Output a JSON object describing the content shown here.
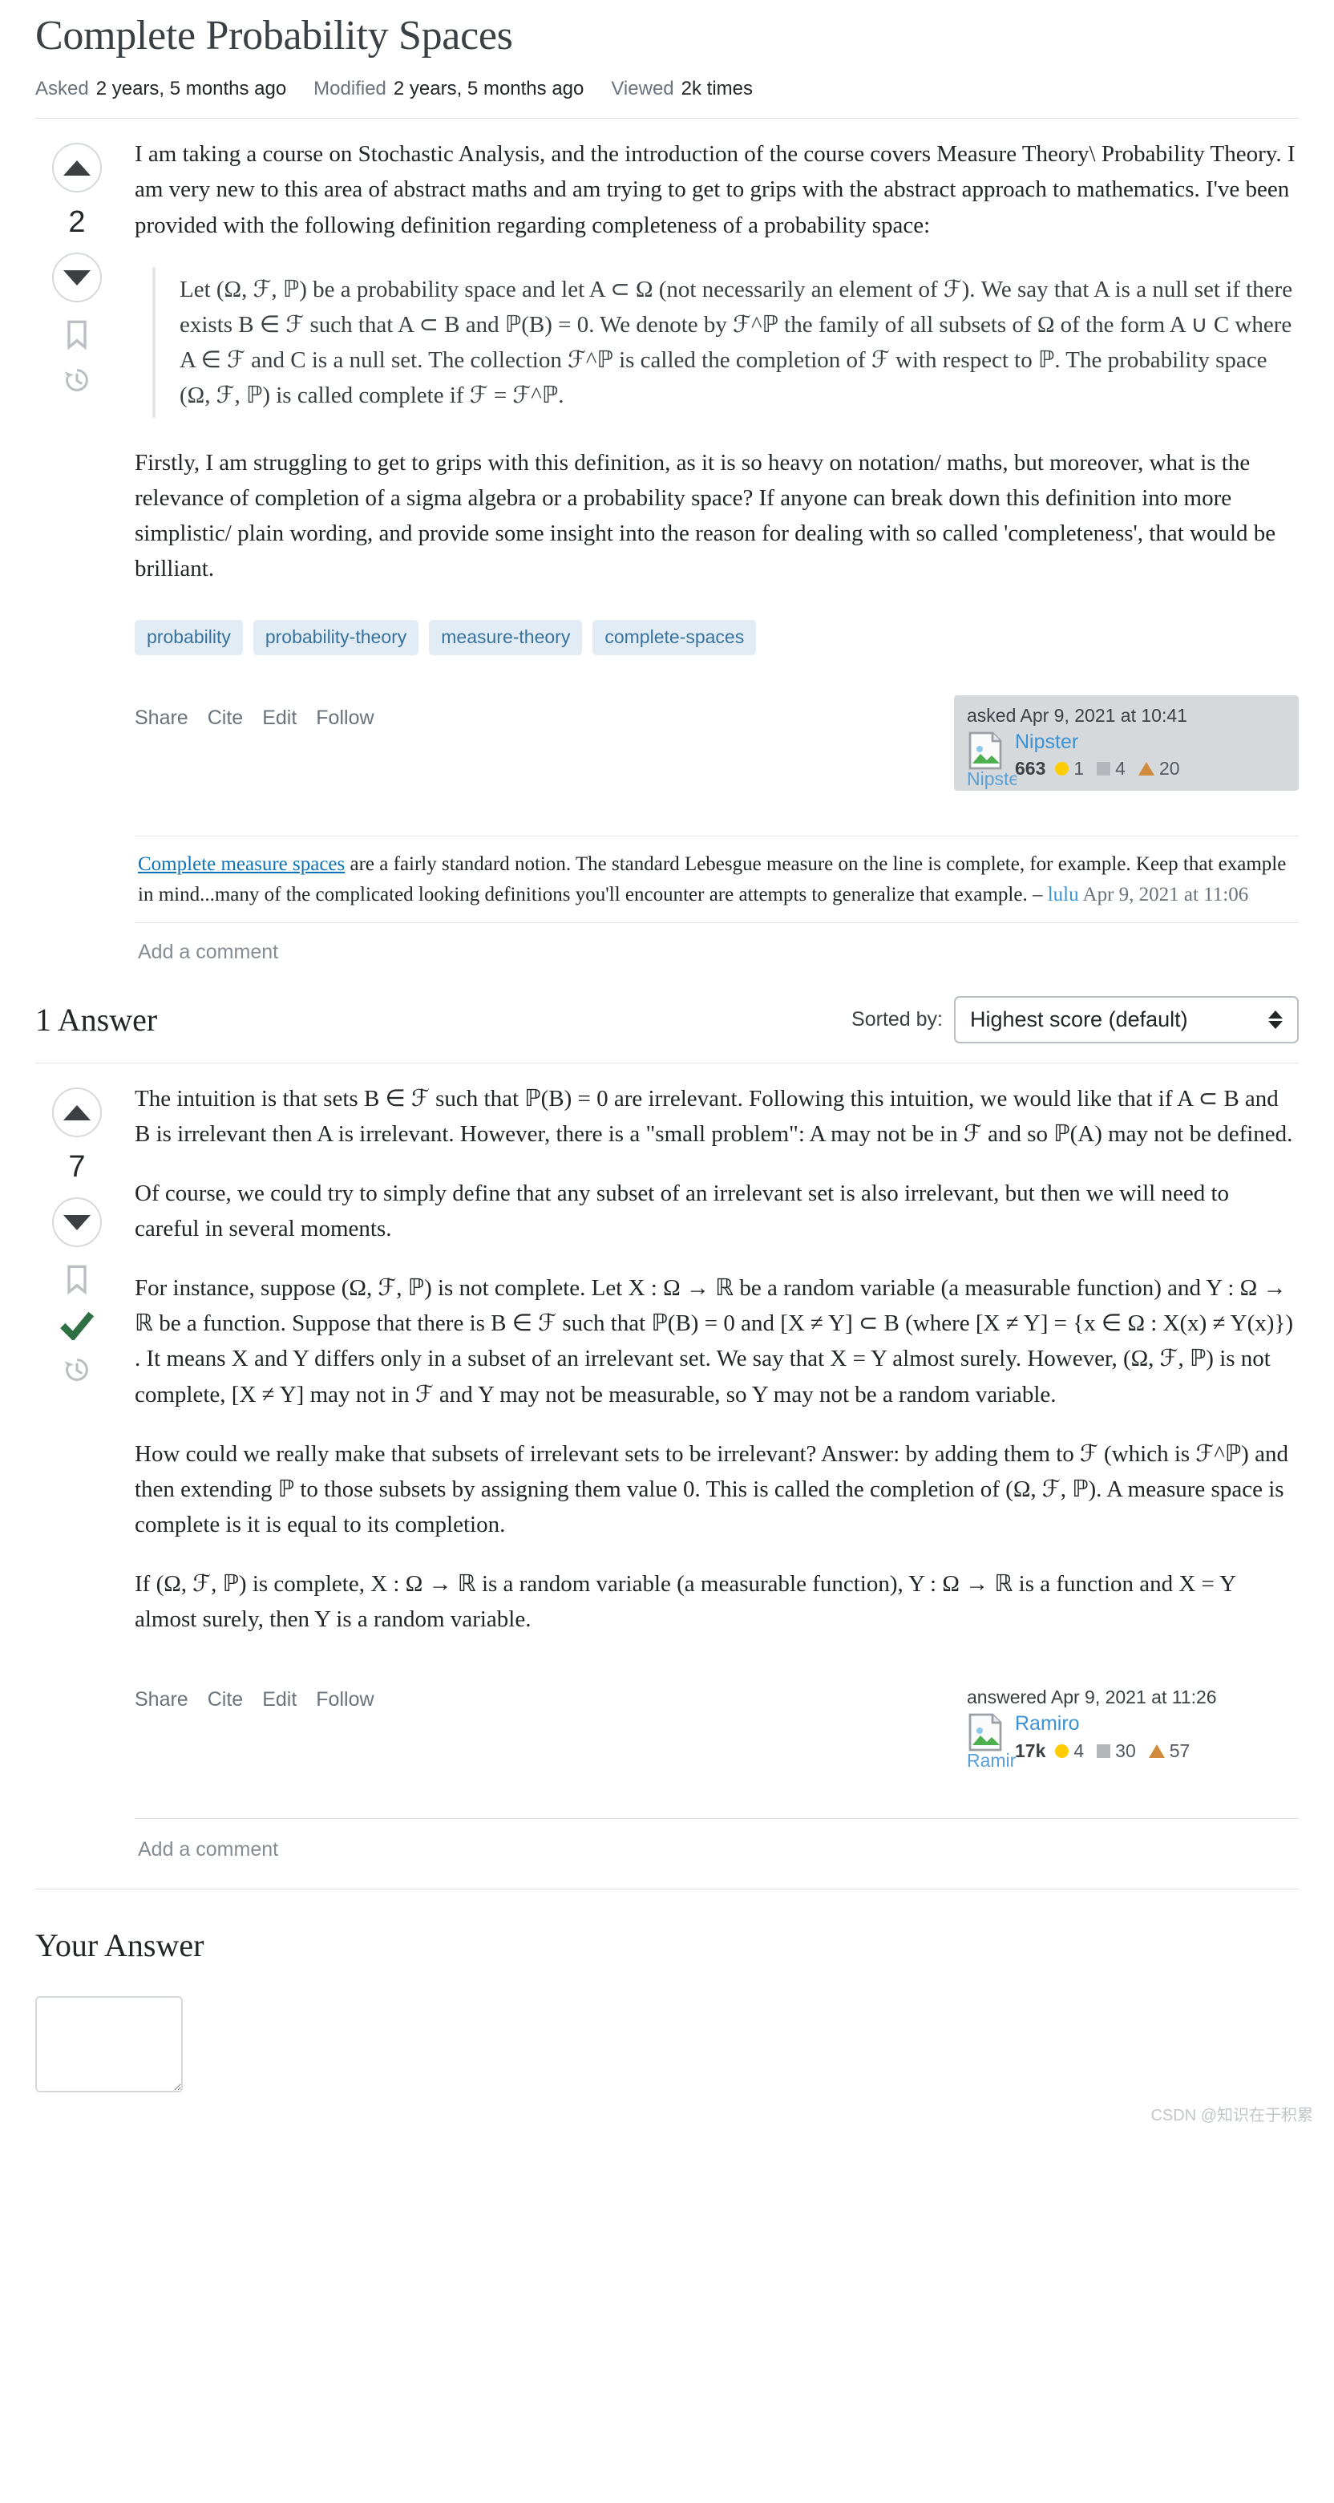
{
  "question": {
    "title": "Complete Probability Spaces",
    "meta": [
      {
        "label": "Asked",
        "value": "2 years, 5 months ago"
      },
      {
        "label": "Modified",
        "value": "2 years, 5 months ago"
      },
      {
        "label": "Viewed",
        "value": "2k times"
      }
    ],
    "vote_score": "2",
    "paragraphs": {
      "p1": "I am taking a course on Stochastic Analysis, and the introduction of the course covers Measure Theory\\ Probability Theory. I am very new to this area of abstract maths and am trying to get to grips with the abstract approach to mathematics. I've been provided with the following definition regarding completeness of a probability space:",
      "p2": "Firstly, I am struggling to get to grips with this definition, as it is so heavy on notation/ maths, but moreover, what is the relevance of completion of a sigma algebra or a probability space? If anyone can break down this definition into more simplistic/ plain wording, and provide some insight into the reason for dealing with so called 'completeness', that would be brilliant."
    },
    "blockquote": {
      "line1": "Let (Ω, ℱ, ℙ) be a probability space and let A ⊂ Ω (not necessarily an element of ℱ). We say that A is a null set if there exists B ∈ ℱ such that A ⊂ B and ℙ(B) = 0. We denote",
      "line2": "by ℱ^ℙ the family of all subsets of Ω of the form A ∪ C where A ∈ ℱ and C is a null set.",
      "line3": "The collection ℱ^ℙ is called the completion of ℱ with respect to ℙ. The probability space (Ω, ℱ, ℙ) is called complete if ℱ = ℱ^ℙ."
    },
    "tags": [
      "probability",
      "probability-theory",
      "measure-theory",
      "complete-spaces"
    ],
    "actions": [
      "Share",
      "Cite",
      "Edit",
      "Follow"
    ],
    "usercard": {
      "time": "asked Apr 9, 2021 at 10:41",
      "avatar_alt": "Nipste",
      "name": "Nipster",
      "reputation": "663",
      "gold": "1",
      "silver": "4",
      "bronze": "20"
    },
    "comment": {
      "link_text": "Complete measure spaces",
      "body": " are a fairly standard notion. The standard Lebesgue measure on the line is complete, for example. Keep that example in mind...many of the complicated looking definitions you'll encounter are attempts to generalize that example. – ",
      "user": "lulu",
      "date": " Apr 9, 2021 at 11:06"
    },
    "add_comment": "Add a comment"
  },
  "answers_section": {
    "heading": "1 Answer",
    "sorted_by_label": "Sorted by:",
    "sort_value": "Highest score (default)"
  },
  "answer": {
    "vote_score": "7",
    "paragraphs": {
      "a1": "The intuition is that sets B ∈ ℱ such that ℙ(B) = 0 are irrelevant. Following this intuition, we would like that if A ⊂ B and B is irrelevant then A is irrelevant. However, there is a \"small problem\": A may not be in ℱ and so ℙ(A) may not be defined.",
      "a2": "Of course, we could try to simply define that any subset of an irrelevant set is also irrelevant, but then we will need to careful in several moments.",
      "a3": "For instance, suppose (Ω, ℱ, ℙ) is not complete. Let X : Ω → ℝ be a random variable (a measurable function) and Y : Ω → ℝ be a function. Suppose that there is B ∈ ℱ such that ℙ(B) = 0 and [X ≠ Y] ⊂ B (where [X ≠ Y] = {x ∈ Ω : X(x) ≠ Y(x)}) . It means X and Y differs only in a subset of an irrelevant set. We say that X = Y almost surely. However, (Ω, ℱ, ℙ) is not complete, [X ≠ Y] may not in ℱ and Y may not be measurable, so Y may not be a random variable.",
      "a4": "How could we really make that subsets of irrelevant sets to be irrelevant? Answer: by adding them to ℱ (which is ℱ^ℙ) and then extending ℙ to those subsets by assigning them value 0. This is called the completion of (Ω, ℱ, ℙ). A measure space is complete is it is equal to its completion.",
      "a5": "If (Ω, ℱ, ℙ) is complete, X : Ω → ℝ is a random variable (a measurable function), Y : Ω → ℝ is a function and X = Y almost surely, then Y is a random variable."
    },
    "actions": [
      "Share",
      "Cite",
      "Edit",
      "Follow"
    ],
    "usercard": {
      "time": "answered Apr 9, 2021 at 11:26",
      "avatar_alt": "Ramir",
      "name": "Ramiro",
      "reputation": "17k",
      "gold": "4",
      "silver": "30",
      "bronze": "57"
    },
    "add_comment": "Add a comment"
  },
  "your_answer": {
    "title": "Your Answer",
    "placeholder": ""
  },
  "watermark": "CSDN @知识在于积累",
  "colors": {
    "accent_link": "#0c73b8",
    "tag_bg": "#e1ecf4",
    "tag_fg": "#39739d",
    "accepted_green": "#2f6f44",
    "gold": "#ffcc01",
    "silver": "#b4b8bc",
    "bronze": "#d1893c"
  }
}
